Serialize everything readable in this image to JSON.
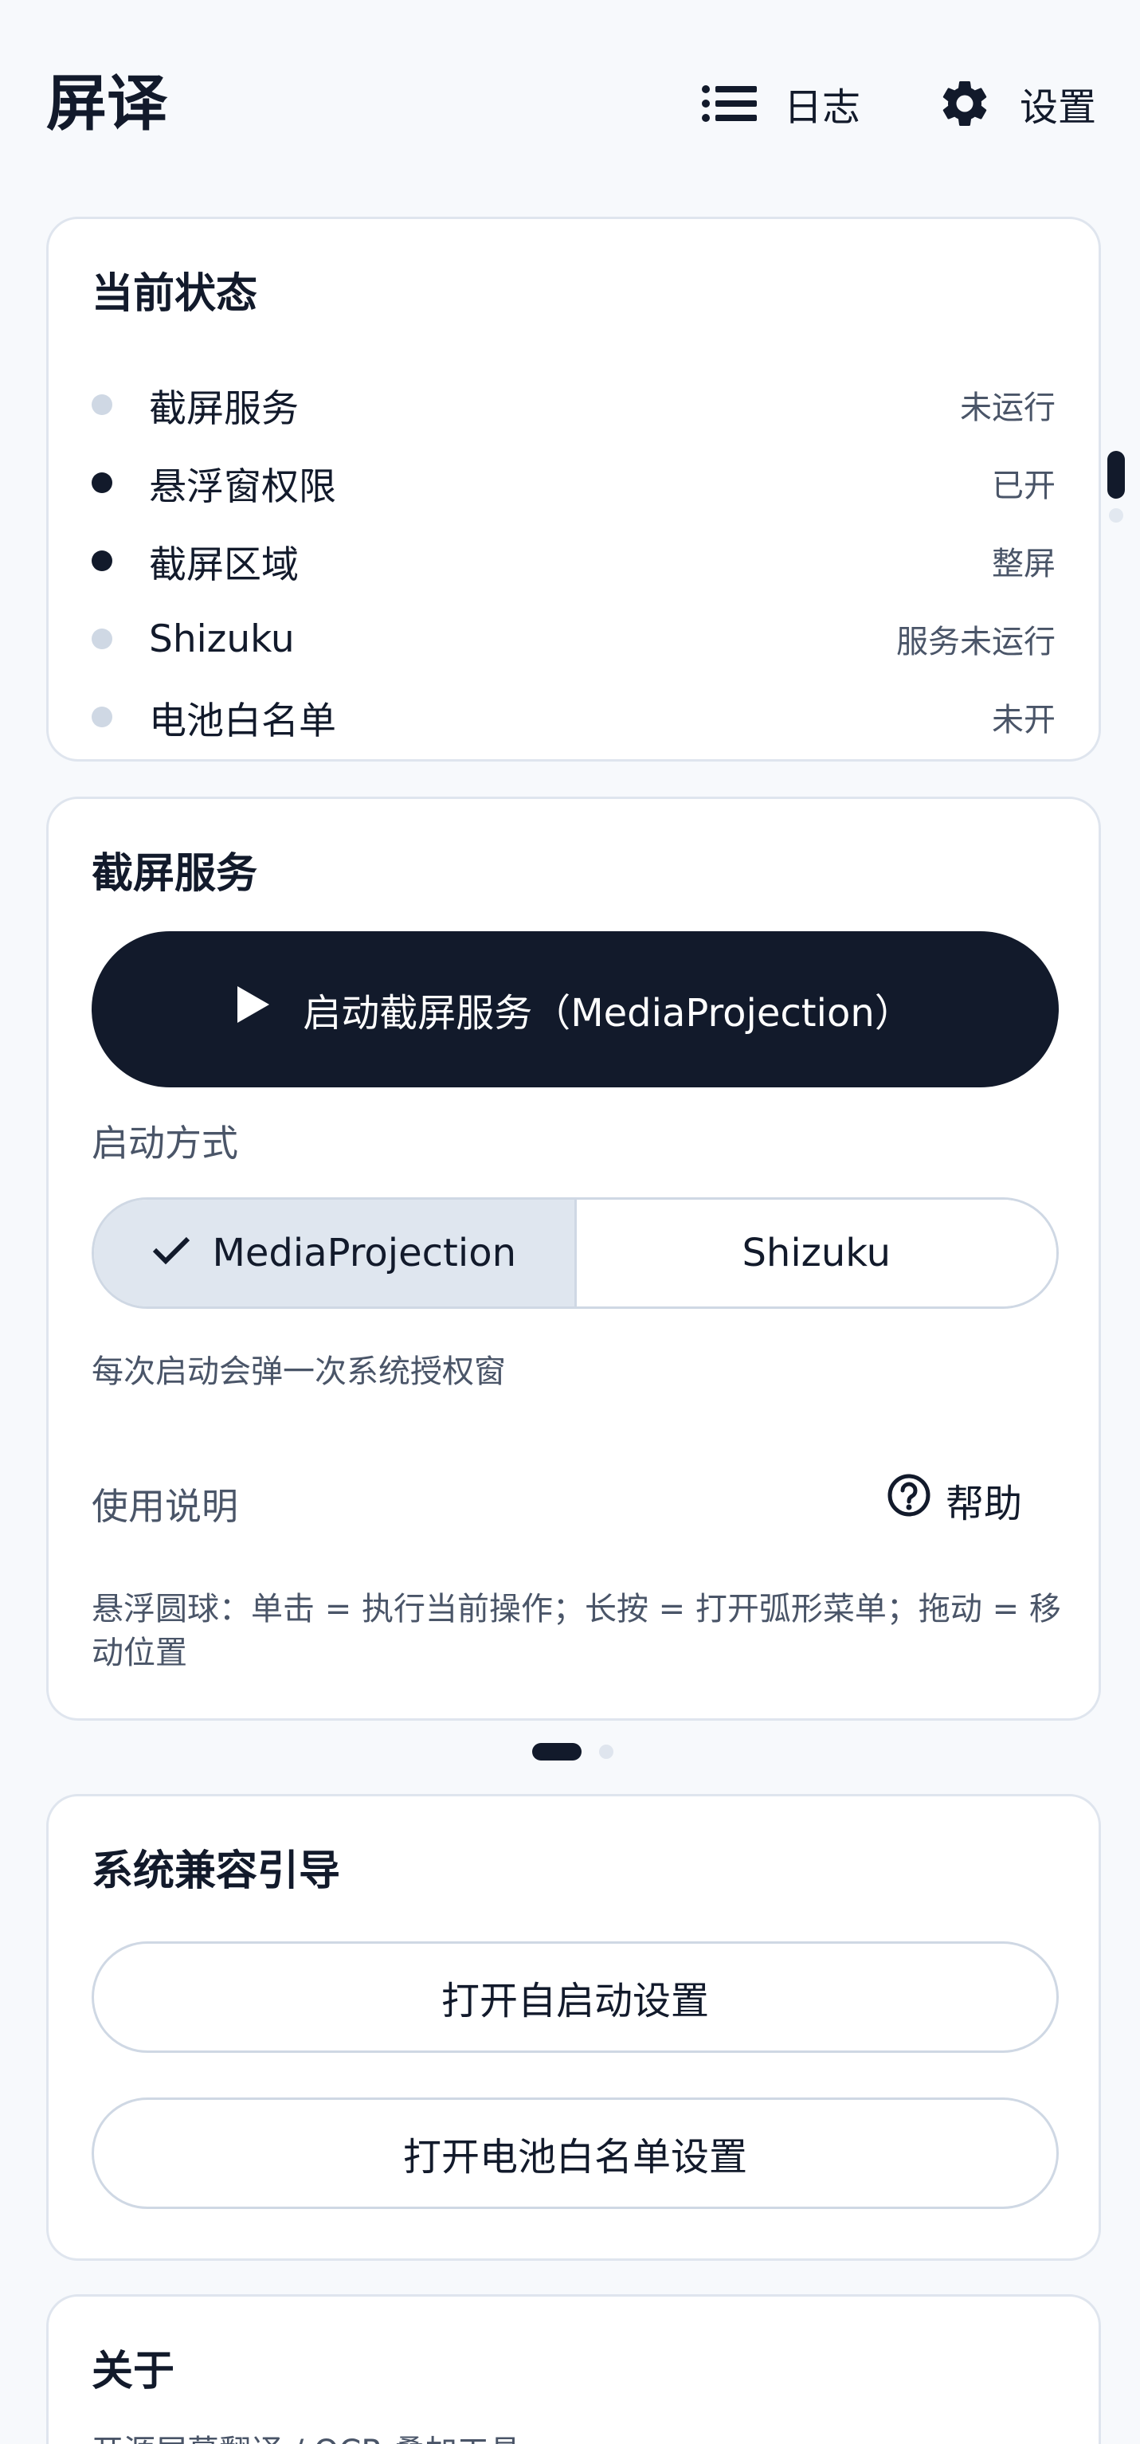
{
  "app": {
    "title": "屏译"
  },
  "toolbar": {
    "log_label": "日志",
    "settings_label": "设置"
  },
  "status": {
    "title": "当前状态",
    "items": [
      {
        "label": "截屏服务",
        "value": "未运行",
        "active": false
      },
      {
        "label": "悬浮窗权限",
        "value": "已开",
        "active": true
      },
      {
        "label": "截屏区域",
        "value": "整屏",
        "active": true
      },
      {
        "label": "Shizuku",
        "value": "服务未运行",
        "active": false
      },
      {
        "label": "电池白名单",
        "value": "未开",
        "active": false
      }
    ]
  },
  "service": {
    "title": "截屏服务",
    "start_button": "启动截屏服务（MediaProjection）",
    "mode_label": "启动方式",
    "modes": [
      {
        "label": "MediaProjection",
        "selected": true
      },
      {
        "label": "Shizuku",
        "selected": false
      }
    ],
    "mode_hint": "每次启动会弹一次系统授权窗",
    "usage_label": "使用说明",
    "help_label": "帮助",
    "usage_text": "悬浮圆球：单击 = 执行当前操作；长按 = 打开弧形菜单；拖动 = 移动位置"
  },
  "pager": {
    "page": 1,
    "total": 2
  },
  "compat": {
    "title": "系统兼容引导",
    "autostart_button": "打开自启动设置",
    "battery_button": "打开电池白名单设置"
  },
  "about": {
    "title": "关于",
    "subtitle": "开源屏幕翻译 / OCR 叠加工具"
  },
  "colors": {
    "primary": "#121a2b",
    "muted": "#4a5568",
    "dot_off": "#cfd8e4",
    "card_border": "#dfe5ee"
  }
}
